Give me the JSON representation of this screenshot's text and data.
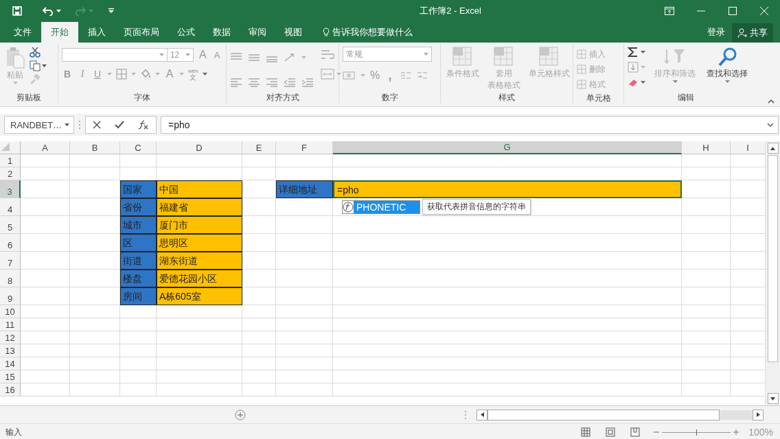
{
  "title_bar": {
    "title": "工作簿2 - Excel"
  },
  "ribbon_tabs": [
    {
      "label": "文件",
      "selected": false
    },
    {
      "label": "开始",
      "selected": true
    },
    {
      "label": "插入",
      "selected": false
    },
    {
      "label": "页面布局",
      "selected": false
    },
    {
      "label": "公式",
      "selected": false
    },
    {
      "label": "数据",
      "selected": false
    },
    {
      "label": "审阅",
      "selected": false
    },
    {
      "label": "视图",
      "selected": false
    }
  ],
  "tell_me": "告诉我你想要做什么",
  "account": {
    "sign_in": "登录",
    "share": "共享"
  },
  "ribbon": {
    "clipboard": {
      "label": "剪贴板",
      "paste": "粘贴"
    },
    "font": {
      "label": "字体",
      "font_size": "12",
      "grow": "A",
      "shrink": "A",
      "bold": "B",
      "italic": "I",
      "underline": "U",
      "font_color": "A",
      "phonetic": [
        "wén",
        "文"
      ]
    },
    "alignment": {
      "label": "对齐方式"
    },
    "number": {
      "label": "数字",
      "format": "常规",
      "percent": "%",
      "comma": ","
    },
    "styles": {
      "label": "样式",
      "buttons": [
        {
          "lines": [
            "条件格式"
          ],
          "disabled": true
        },
        {
          "lines": [
            "套用",
            "表格格式"
          ],
          "disabled": true
        },
        {
          "lines": [
            "单元格样式"
          ],
          "disabled": true
        }
      ]
    },
    "cells": {
      "label": "单元格",
      "buttons": [
        {
          "label": "插入",
          "disabled": true
        },
        {
          "label": "删除",
          "disabled": true
        },
        {
          "label": "格式",
          "disabled": true
        }
      ]
    },
    "editing": {
      "label": "编辑",
      "buttons": [
        {
          "label": "排序和筛选",
          "disabled": true
        },
        {
          "label": "查找和选择",
          "disabled": false
        }
      ]
    }
  },
  "formula_bar": {
    "name_box": "RANDBET…",
    "formula": "=pho"
  },
  "sheet": {
    "columns": [
      {
        "label": "A",
        "selected": false
      },
      {
        "label": "B",
        "selected": false
      },
      {
        "label": "C",
        "selected": false
      },
      {
        "label": "D",
        "selected": false
      },
      {
        "label": "E",
        "selected": false
      },
      {
        "label": "F",
        "selected": false
      },
      {
        "label": "G",
        "selected": true
      },
      {
        "label": "H",
        "selected": false
      },
      {
        "label": "I",
        "selected": false
      }
    ],
    "rows": [
      {
        "label": "1",
        "selected": false,
        "cells": [
          null,
          null,
          null,
          null,
          null,
          null,
          null,
          null,
          null
        ]
      },
      {
        "label": "2",
        "selected": false,
        "cells": [
          null,
          null,
          null,
          null,
          null,
          null,
          null,
          null,
          null
        ]
      },
      {
        "label": "3",
        "selected": true,
        "cells": [
          null,
          null,
          {
            "text": "国家",
            "color": "#2e75c6"
          },
          {
            "text": "中国",
            "color": "#ffc000"
          },
          null,
          {
            "text": "详细地址",
            "color": "#2e75c6"
          },
          {
            "text": "=pho",
            "color": "#ffc000",
            "active": true
          },
          null,
          null
        ]
      },
      {
        "label": "4",
        "selected": false,
        "cells": [
          null,
          null,
          {
            "text": "省份",
            "color": "#2e75c6"
          },
          {
            "text": "福建省",
            "color": "#ffc000"
          },
          null,
          null,
          null,
          null,
          null
        ]
      },
      {
        "label": "5",
        "selected": false,
        "cells": [
          null,
          null,
          {
            "text": "城市",
            "color": "#2e75c6"
          },
          {
            "text": "厦门市",
            "color": "#ffc000"
          },
          null,
          null,
          null,
          null,
          null
        ]
      },
      {
        "label": "6",
        "selected": false,
        "cells": [
          null,
          null,
          {
            "text": "区",
            "color": "#2e75c6"
          },
          {
            "text": "思明区",
            "color": "#ffc000"
          },
          null,
          null,
          null,
          null,
          null
        ]
      },
      {
        "label": "7",
        "selected": false,
        "cells": [
          null,
          null,
          {
            "text": "街道",
            "color": "#2e75c6"
          },
          {
            "text": "湖东街道",
            "color": "#ffc000"
          },
          null,
          null,
          null,
          null,
          null
        ]
      },
      {
        "label": "8",
        "selected": false,
        "cells": [
          null,
          null,
          {
            "text": "楼盘",
            "color": "#2e75c6"
          },
          {
            "text": "爱德花园小区",
            "color": "#ffc000"
          },
          null,
          null,
          null,
          null,
          null
        ]
      },
      {
        "label": "9",
        "selected": false,
        "cells": [
          null,
          null,
          {
            "text": "房间",
            "color": "#2e75c6"
          },
          {
            "text": "A栋605室",
            "color": "#ffc000"
          },
          null,
          null,
          null,
          null,
          null
        ]
      },
      {
        "label": "10",
        "selected": false,
        "cells": [
          null,
          null,
          null,
          null,
          null,
          null,
          null,
          null,
          null
        ]
      },
      {
        "label": "11",
        "selected": false,
        "cells": [
          null,
          null,
          null,
          null,
          null,
          null,
          null,
          null,
          null
        ]
      },
      {
        "label": "12",
        "selected": false,
        "cells": [
          null,
          null,
          null,
          null,
          null,
          null,
          null,
          null,
          null
        ]
      },
      {
        "label": "13",
        "selected": false,
        "cells": [
          null,
          null,
          null,
          null,
          null,
          null,
          null,
          null,
          null
        ]
      },
      {
        "label": "14",
        "selected": false,
        "cells": [
          null,
          null,
          null,
          null,
          null,
          null,
          null,
          null,
          null
        ]
      },
      {
        "label": "15",
        "selected": false,
        "cells": [
          null,
          null,
          null,
          null,
          null,
          null,
          null,
          null,
          null
        ]
      },
      {
        "label": "16",
        "selected": false,
        "cells": [
          null,
          null,
          null,
          null,
          null,
          null,
          null,
          null,
          null
        ]
      }
    ]
  },
  "autocomplete": {
    "items": [
      {
        "function": "PHONETIC",
        "selected": true
      }
    ],
    "tooltip": "获取代表拼音信息的字符串"
  },
  "status_bar": {
    "mode": "输入",
    "zoom": {
      "level": 0.5,
      "reading": "100%"
    }
  }
}
